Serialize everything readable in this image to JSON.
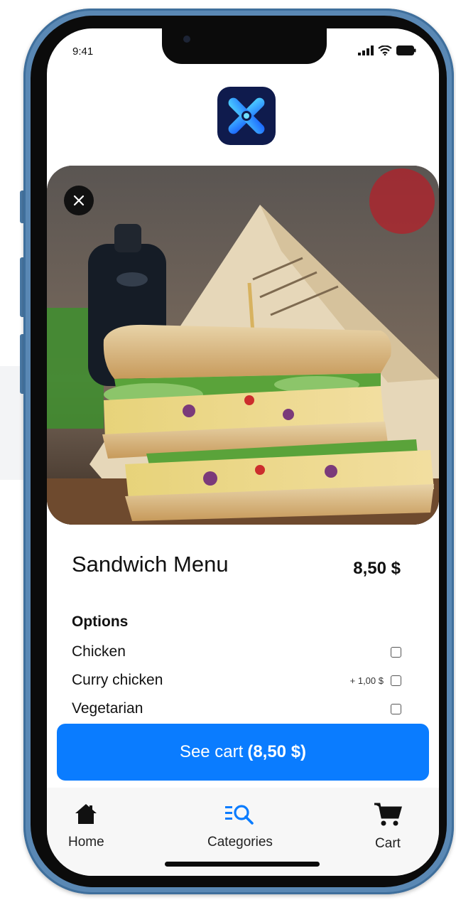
{
  "status_bar": {
    "time": "9:41",
    "icons": [
      "signal-icon",
      "wifi-icon",
      "battery-icon"
    ]
  },
  "brand": {
    "logo_icon": "app-logo-icon",
    "accent": "#0a7cff"
  },
  "hero": {
    "image": "sandwich-photo",
    "close_icon": "close-icon"
  },
  "item": {
    "name": "Sandwich Menu",
    "price": "8,50 $"
  },
  "options": {
    "title": "Options",
    "items": [
      {
        "label": "Chicken",
        "extra": "",
        "checked": false
      },
      {
        "label": "Curry chicken",
        "extra": "+ 1,00 $",
        "checked": false
      },
      {
        "label": "Vegetarian",
        "extra": "",
        "checked": false
      }
    ]
  },
  "cart_button": {
    "label": "See cart",
    "amount": "(8,50 $)"
  },
  "tabs": [
    {
      "label": "Home",
      "icon": "home-icon",
      "active": false
    },
    {
      "label": "Categories",
      "icon": "categories-search-icon",
      "active": true
    },
    {
      "label": "Cart",
      "icon": "cart-icon",
      "active": false
    }
  ]
}
